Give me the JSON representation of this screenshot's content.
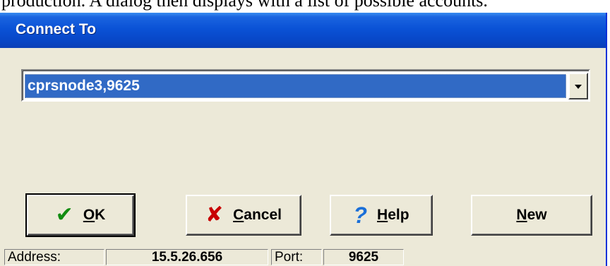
{
  "document": {
    "text": "production. A dialog then displays with a list of possible accounts."
  },
  "dialog": {
    "title": "Connect To",
    "server_select": {
      "value": "cprsnode3,9625"
    },
    "buttons": {
      "ok": {
        "accel": "O",
        "rest": "K"
      },
      "cancel": {
        "accel": "C",
        "rest": "ancel"
      },
      "help": {
        "accel": "H",
        "rest": "elp"
      },
      "new": {
        "accel": "N",
        "rest": "ew"
      }
    },
    "icons": {
      "ok": "checkmark-icon",
      "cancel": "x-icon",
      "help": "question-mark-icon"
    },
    "colors": {
      "titlebar": "#0a52d6",
      "selection": "#316ac5",
      "dialog_bg": "#ece9d8"
    },
    "status": {
      "address_label": "Address:",
      "address_value": "15.5.26.656",
      "port_label": "Port:",
      "port_value": "9625"
    }
  }
}
